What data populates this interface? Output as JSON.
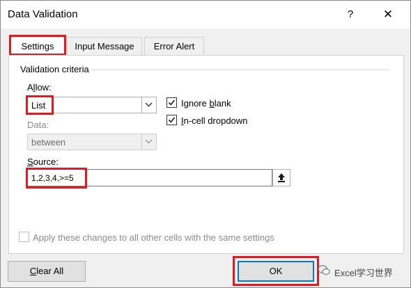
{
  "dialog": {
    "title": "Data Validation",
    "help_label": "?",
    "close_label": "✕"
  },
  "tabs": [
    {
      "label": "Settings",
      "active": true
    },
    {
      "label": "Input Message",
      "active": false
    },
    {
      "label": "Error Alert",
      "active": false
    }
  ],
  "criteria": {
    "group_label": "Validation criteria",
    "allow": {
      "label_prefix": "A",
      "label_underline": "l",
      "label_suffix": "low:",
      "value": "List"
    },
    "data": {
      "label": "Data:",
      "value": "between"
    },
    "source": {
      "label_underline": "S",
      "label_suffix": "ource:",
      "value": "1,2,3,4,>=5"
    },
    "ignore_blank": {
      "label_prefix": "Ignore ",
      "label_underline": "b",
      "label_suffix": "lank",
      "checked": true
    },
    "in_cell_dropdown": {
      "label_underline": "I",
      "label_suffix": "n-cell dropdown",
      "checked": true
    },
    "apply_all": {
      "label": "Apply these changes to all other cells with the same settings",
      "checked": false
    }
  },
  "buttons": {
    "clear_all": {
      "label_underline": "C",
      "label_suffix": "lear All"
    },
    "ok": "OK"
  },
  "watermark": "Excel学习世界",
  "colors": {
    "highlight": "#e01a22",
    "focus": "#0078d7"
  }
}
